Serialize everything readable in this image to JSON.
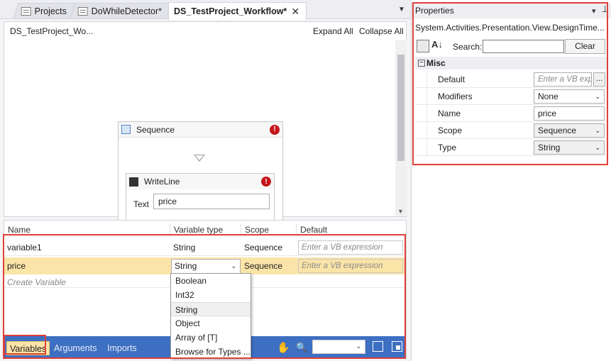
{
  "tabs": [
    {
      "label": "Projects"
    },
    {
      "label": "DoWhileDetector*"
    },
    {
      "label": "DS_TestProject_Workflow*",
      "close": "✕"
    }
  ],
  "designer": {
    "breadcrumb": "DS_TestProject_Wo...",
    "expand_all": "Expand All",
    "collapse_all": "Collapse All",
    "sequence": {
      "title": "Sequence",
      "error": "!"
    },
    "writeline": {
      "title": "WriteLine",
      "error": "!",
      "text_label": "Text",
      "text_value": "price"
    }
  },
  "variables": {
    "headers": {
      "name": "Name",
      "type": "Variable type",
      "scope": "Scope",
      "default": "Default"
    },
    "rows": [
      {
        "name": "variable1",
        "type": "String",
        "scope": "Sequence",
        "default_placeholder": "Enter a VB expression"
      },
      {
        "name": "price",
        "type": "String",
        "scope": "Sequence",
        "default_placeholder": "Enter a VB expression"
      }
    ],
    "create_placeholder": "Create Variable",
    "type_options": [
      "Boolean",
      "Int32",
      "String",
      "Object",
      "Array of [T]",
      "Browse for Types ..."
    ]
  },
  "bottom_bar": {
    "variables": "Variables",
    "arguments": "Arguments",
    "imports": "Imports"
  },
  "properties": {
    "title": "Properties",
    "object_type": "System.Activities.Presentation.View.DesignTime...",
    "search_label": "Search:",
    "clear_label": "Clear",
    "category": "Misc",
    "rows": [
      {
        "label": "Default",
        "value": "Enter a VB exp",
        "ellipsis": "..."
      },
      {
        "label": "Modifiers",
        "value": "None"
      },
      {
        "label": "Name",
        "value": "price"
      },
      {
        "label": "Scope",
        "value": "Sequence"
      },
      {
        "label": "Type",
        "value": "String"
      }
    ]
  },
  "colors": {
    "accent_bar": "#3d6fc2",
    "selected_row": "#fbe4a8",
    "highlight_box": "#e0403a",
    "error": "#c4161c"
  }
}
